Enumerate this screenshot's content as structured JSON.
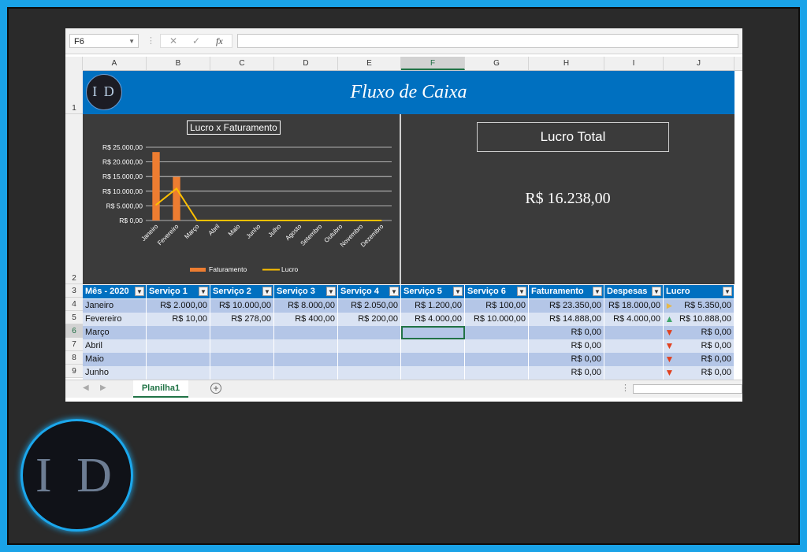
{
  "formula_bar": {
    "name_box": "F6",
    "fx": "fx",
    "cancel": "✕",
    "confirm": "✓"
  },
  "columns": [
    "A",
    "B",
    "C",
    "D",
    "E",
    "F",
    "G",
    "H",
    "I",
    "J"
  ],
  "rows": [
    "1",
    "2",
    "3",
    "4",
    "5",
    "6",
    "7",
    "8",
    "9"
  ],
  "banner": {
    "title": "Fluxo de Caixa",
    "logo": "I D"
  },
  "chart_panel": {
    "title": "Lucro x Faturamento"
  },
  "chart_data": {
    "type": "bar",
    "title": "Lucro x Faturamento",
    "categories": [
      "Janeiro",
      "Fevereiro",
      "Março",
      "Abril",
      "Maio",
      "Junho",
      "Julho",
      "Agosto",
      "Setembro",
      "Outubro",
      "Novembro",
      "Dezembro"
    ],
    "series": [
      {
        "name": "Faturamento",
        "type": "bar",
        "color": "#ed7d31",
        "values": [
          23350,
          14888,
          0,
          0,
          0,
          0,
          0,
          0,
          0,
          0,
          0,
          0
        ]
      },
      {
        "name": "Lucro",
        "type": "line",
        "color": "#ffc000",
        "values": [
          5350,
          10888,
          0,
          0,
          0,
          0,
          0,
          0,
          0,
          0,
          0,
          0
        ]
      }
    ],
    "y_ticks": [
      "R$ 25.000,00",
      "R$ 20.000,00",
      "R$ 15.000,00",
      "R$ 10.000,00",
      "R$ 5.000,00",
      "R$ 0,00"
    ],
    "ylim": [
      0,
      25000
    ],
    "grid": true,
    "legend": "bottom"
  },
  "summary": {
    "label": "Lucro Total",
    "value": "R$ 16.238,00"
  },
  "table": {
    "headers": [
      "Mês - 2020",
      "Serviço 1",
      "Serviço 2",
      "Serviço 3",
      "Serviço 4",
      "Serviço 5",
      "Serviço 6",
      "Faturamento",
      "Despesas",
      "Lucro"
    ],
    "rows": [
      {
        "cells": [
          "Janeiro",
          "R$ 2.000,00",
          "R$ 10.000,00",
          "R$ 8.000,00",
          "R$ 2.050,00",
          "R$ 1.200,00",
          "R$ 100,00",
          "R$ 23.350,00",
          "R$ 18.000,00",
          "R$ 5.350,00"
        ],
        "trend": "sideways",
        "trend_color": "#e6b84a"
      },
      {
        "cells": [
          "Fevereiro",
          "R$ 10,00",
          "R$ 278,00",
          "R$ 400,00",
          "R$ 200,00",
          "R$ 4.000,00",
          "R$ 10.000,00",
          "R$ 14.888,00",
          "R$ 4.000,00",
          "R$ 10.888,00"
        ],
        "trend": "up",
        "trend_color": "#3fa66b"
      },
      {
        "cells": [
          "Março",
          "",
          "",
          "",
          "",
          "",
          "",
          "R$ 0,00",
          "",
          "R$ 0,00"
        ],
        "trend": "down",
        "trend_color": "#e0411f"
      },
      {
        "cells": [
          "Abril",
          "",
          "",
          "",
          "",
          "",
          "",
          "R$ 0,00",
          "",
          "R$ 0,00"
        ],
        "trend": "down",
        "trend_color": "#e0411f"
      },
      {
        "cells": [
          "Maio",
          "",
          "",
          "",
          "",
          "",
          "",
          "R$ 0,00",
          "",
          "R$ 0,00"
        ],
        "trend": "down",
        "trend_color": "#e0411f"
      },
      {
        "cells": [
          "Junho",
          "",
          "",
          "",
          "",
          "",
          "",
          "R$ 0,00",
          "",
          "R$ 0,00"
        ],
        "trend": "down",
        "trend_color": "#e0411f"
      }
    ]
  },
  "sheet_tabs": {
    "active": "Planilha1",
    "add": "+"
  },
  "watermark_logo": "I D"
}
